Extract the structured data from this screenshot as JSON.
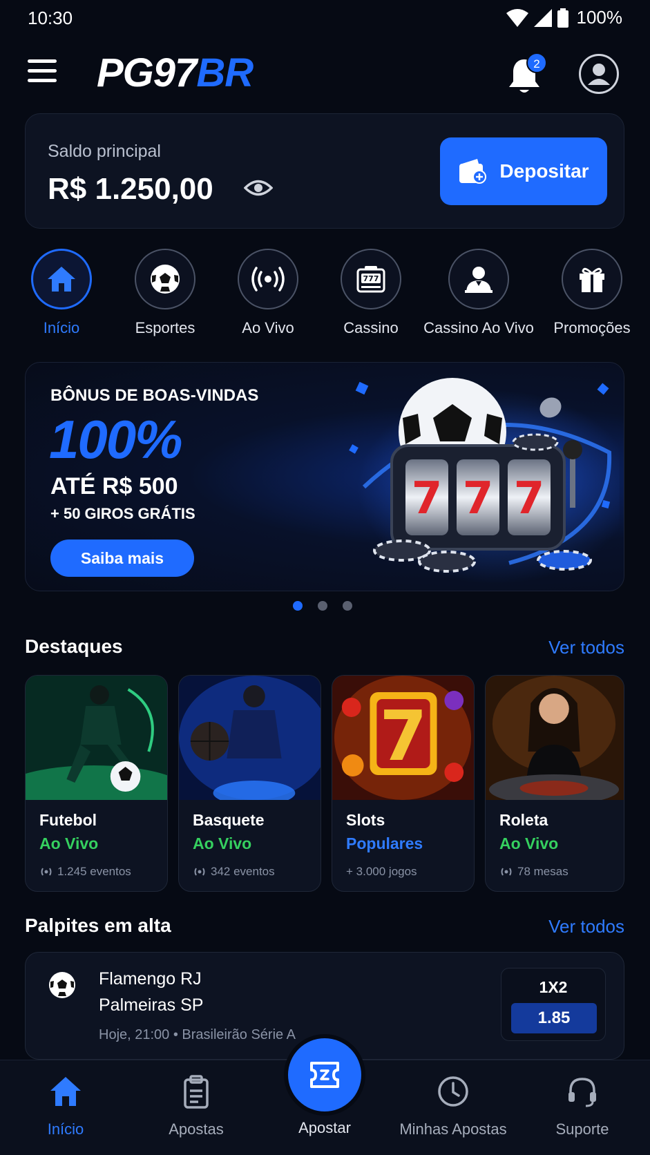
{
  "status": {
    "time": "10:30",
    "battery": "100%"
  },
  "header": {
    "logo_main": "PG97",
    "logo_accent": "BR",
    "notifications": "2"
  },
  "balance": {
    "label": "Saldo principal",
    "value": "R$ 1.250,00",
    "deposit_label": "Depositar"
  },
  "categories": [
    {
      "label": "Início",
      "icon": "home-icon",
      "active": true
    },
    {
      "label": "Esportes",
      "icon": "soccer-ball-icon"
    },
    {
      "label": "Ao Vivo",
      "icon": "live-broadcast-icon"
    },
    {
      "label": "Cassino",
      "icon": "slot-machine-icon"
    },
    {
      "label": "Cassino Ao Vivo",
      "icon": "dealer-icon"
    },
    {
      "label": "Promoções",
      "icon": "gift-icon"
    }
  ],
  "banner": {
    "kicker": "BÔNUS DE BOAS-VINDAS",
    "big": "100%",
    "amount": "ATÉ R$ 500",
    "spins": "+ 50 GIROS GRÁTIS",
    "button": "Saiba mais",
    "slot_digits": [
      "7",
      "7",
      "7"
    ]
  },
  "highlights": {
    "title": "Destaques",
    "link": "Ver todos",
    "items": [
      {
        "title": "Futebol",
        "subtitle": "Ao Vivo",
        "meta": "1.245 eventos",
        "accent": "#35d05f"
      },
      {
        "title": "Basquete",
        "subtitle": "Ao Vivo",
        "meta": "342 eventos",
        "accent": "#35d05f"
      },
      {
        "title": "Slots",
        "subtitle": "Populares",
        "meta": "+ 3.000 jogos",
        "accent": "#2f7bff"
      },
      {
        "title": "Roleta",
        "subtitle": "Ao Vivo",
        "meta": "78 mesas",
        "accent": "#35d05f"
      }
    ]
  },
  "tips": {
    "title": "Palpites em alta",
    "link": "Ver todos",
    "item": {
      "team1": "Flamengo RJ",
      "team2": "Palmeiras SP",
      "meta": "Hoje, 21:00 • Brasileirão Série A",
      "market": "1X2",
      "odd": "1.85"
    }
  },
  "nav": {
    "items": [
      "Início",
      "Apostas",
      "Apostar",
      "Minhas Apostas",
      "Suporte"
    ]
  },
  "colors": {
    "accent": "#1f6bff",
    "live": "#35d05f",
    "background": "#060a14"
  }
}
